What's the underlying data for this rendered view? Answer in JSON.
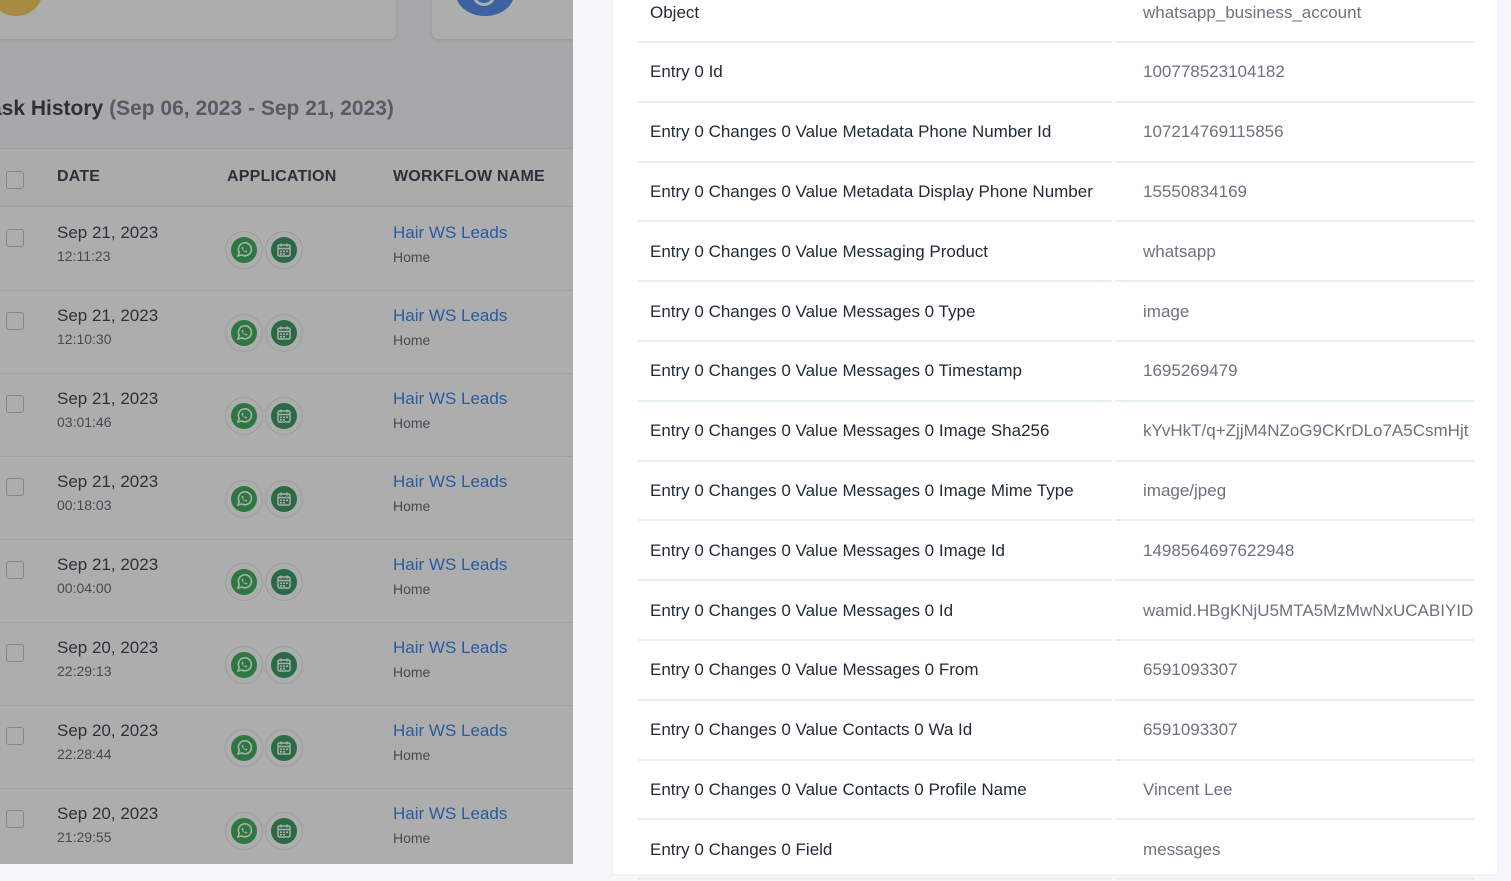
{
  "history": {
    "title": "ask History",
    "range": "(Sep 06, 2023 - Sep 21, 2023)"
  },
  "table": {
    "columns": [
      "DATE",
      "APPLICATION",
      "WORKFLOW NAME"
    ],
    "rows": [
      {
        "date": "Sep 21, 2023",
        "time": "12:11:23",
        "workflow": "Hair WS Leads",
        "folder": "Home"
      },
      {
        "date": "Sep 21, 2023",
        "time": "12:10:30",
        "workflow": "Hair WS Leads",
        "folder": "Home"
      },
      {
        "date": "Sep 21, 2023",
        "time": "03:01:46",
        "workflow": "Hair WS Leads",
        "folder": "Home"
      },
      {
        "date": "Sep 21, 2023",
        "time": "00:18:03",
        "workflow": "Hair WS Leads",
        "folder": "Home"
      },
      {
        "date": "Sep 21, 2023",
        "time": "00:04:00",
        "workflow": "Hair WS Leads",
        "folder": "Home"
      },
      {
        "date": "Sep 20, 2023",
        "time": "22:29:13",
        "workflow": "Hair WS Leads",
        "folder": "Home"
      },
      {
        "date": "Sep 20, 2023",
        "time": "22:28:44",
        "workflow": "Hair WS Leads",
        "folder": "Home"
      },
      {
        "date": "Sep 20, 2023",
        "time": "21:29:55",
        "workflow": "Hair WS Leads",
        "folder": "Home"
      }
    ],
    "app_icons": [
      "whatsapp-icon",
      "calendar-icon"
    ]
  },
  "colors": {
    "link": "#1a73e8",
    "whatsapp": "#25a244",
    "calendar": "#1e8e4e"
  },
  "details": [
    {
      "key": "Object",
      "value": "whatsapp_business_account"
    },
    {
      "key": "Entry 0 Id",
      "value": "100778523104182"
    },
    {
      "key": "Entry 0 Changes 0 Value Metadata Phone Number Id",
      "value": "107214769115856"
    },
    {
      "key": "Entry 0 Changes 0 Value Metadata Display Phone Number",
      "value": "15550834169"
    },
    {
      "key": "Entry 0 Changes 0 Value Messaging Product",
      "value": "whatsapp"
    },
    {
      "key": "Entry 0 Changes 0 Value Messages 0 Type",
      "value": "image"
    },
    {
      "key": "Entry 0 Changes 0 Value Messages 0 Timestamp",
      "value": "1695269479"
    },
    {
      "key": "Entry 0 Changes 0 Value Messages 0 Image Sha256",
      "value": "kYvHkT/q+ZjjM4NZoG9CKrDLo7A5CsmHjt"
    },
    {
      "key": "Entry 0 Changes 0 Value Messages 0 Image Mime Type",
      "value": "image/jpeg"
    },
    {
      "key": "Entry 0 Changes 0 Value Messages 0 Image Id",
      "value": "1498564697622948"
    },
    {
      "key": "Entry 0 Changes 0 Value Messages 0 Id",
      "value": "wamid.HBgKNjU5MTA5MzMwNxUCABIYID"
    },
    {
      "key": "Entry 0 Changes 0 Value Messages 0 From",
      "value": "6591093307"
    },
    {
      "key": "Entry 0 Changes 0 Value Contacts 0 Wa Id",
      "value": "6591093307"
    },
    {
      "key": "Entry 0 Changes 0 Value Contacts 0 Profile Name",
      "value": "Vincent Lee"
    },
    {
      "key": "Entry 0 Changes 0 Field",
      "value": "messages"
    }
  ]
}
